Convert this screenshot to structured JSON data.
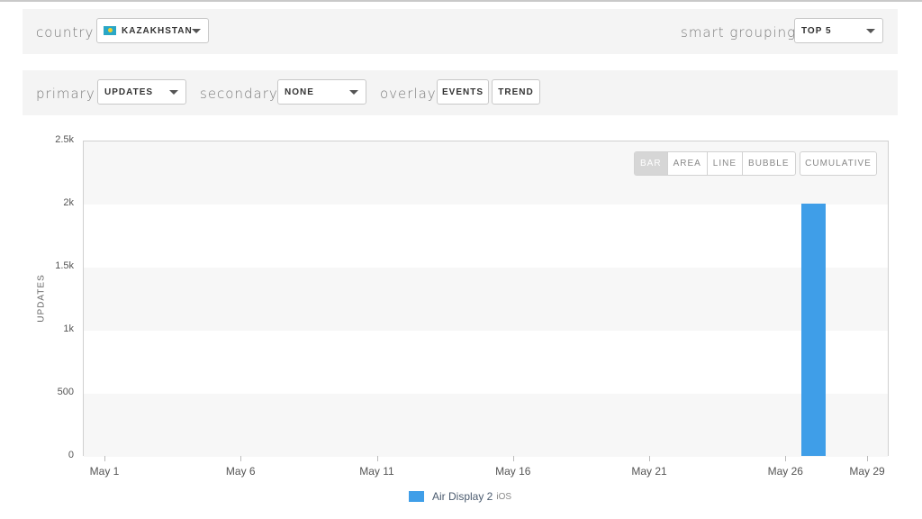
{
  "filters": {
    "country_label": "country",
    "country_value": "KAZAKHSTAN",
    "grouping_label": "smart grouping",
    "grouping_value": "TOP 5",
    "primary_label": "primary",
    "primary_value": "UPDATES",
    "secondary_label": "secondary",
    "secondary_value": "NONE",
    "overlay_label": "overlay",
    "events_label": "EVENTS",
    "trend_label": "TREND"
  },
  "chart_types": [
    "BAR",
    "AREA",
    "LINE",
    "BUBBLE"
  ],
  "active_chart_type": "BAR",
  "cumulative_label": "CUMULATIVE",
  "colors": {
    "series": "#3f9ee8"
  },
  "chart_data": {
    "type": "bar",
    "title": "",
    "xlabel": "",
    "ylabel": "UPDATES",
    "ylim": [
      0,
      2500
    ],
    "yticks": [
      "2.5k",
      "2k",
      "1.5k",
      "1k",
      "500",
      "0"
    ],
    "xticks": [
      "May 1",
      "May 6",
      "May 11",
      "May 16",
      "May 21",
      "May 26",
      "May 29"
    ],
    "x_range": [
      "May 1",
      "May 29"
    ],
    "grid": "horizontal bands",
    "legend_position": "bottom",
    "series": [
      {
        "name": "Air Display 2",
        "platform": "iOS",
        "points": [
          {
            "x": "May 27",
            "y": 2000
          }
        ]
      }
    ]
  }
}
